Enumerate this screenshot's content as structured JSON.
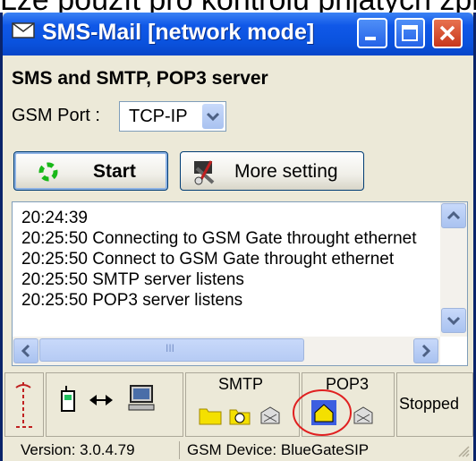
{
  "background_text": "Lze použít pro kontrolu přijatých zpráv",
  "window": {
    "title": "SMS-Mail  [network mode]",
    "colors": {
      "titlebar": "#0a52dd",
      "close_button": "#c7371d",
      "face": "#ece9d8",
      "highlight_circle": "#e02020"
    }
  },
  "header": "SMS and SMTP, POP3 server",
  "gsm_port": {
    "label": "GSM Port :",
    "value": "TCP-IP"
  },
  "buttons": {
    "start": "Start",
    "more_setting": "More setting"
  },
  "log": {
    "lines": [
      "20:24:39",
      "20:25:50  Connecting to GSM Gate throught ethernet",
      "20:25:50  Connect to GSM Gate throught ethernet",
      "20:25:50  SMTP server listens",
      "20:25:50  POP3 server listens"
    ],
    "scroll_marks": "III"
  },
  "status_panels": {
    "smtp_label": "SMTP",
    "pop3_label": "POP3",
    "state": "Stopped"
  },
  "statusbar": {
    "version": "Version: 3.0.4.79",
    "device": "GSM Device: BlueGateSIP"
  },
  "icons": [
    "envelope-icon",
    "minimize-icon",
    "maximize-icon",
    "close-icon",
    "start-icon",
    "tools-icon",
    "antenna-signal-icon",
    "gsm-phone-icon",
    "transfer-arrows-icon",
    "computer-icon",
    "folder-icon",
    "clock-icon",
    "mailbox-icon",
    "home-folder-icon"
  ]
}
